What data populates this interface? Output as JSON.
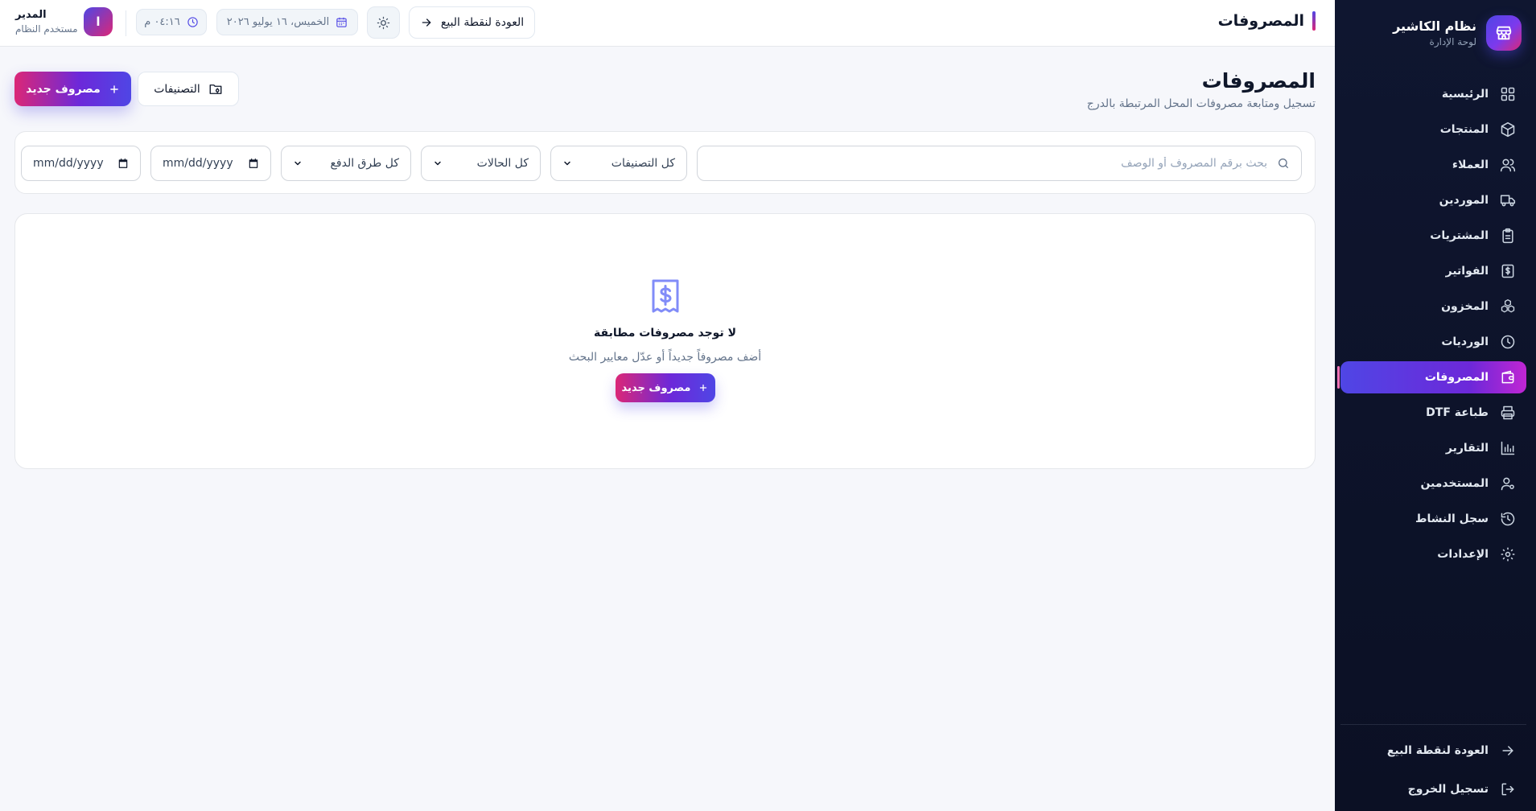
{
  "sidebar": {
    "brand_title": "نظام الكاشير",
    "brand_subtitle": "لوحة الإدارة",
    "items": [
      {
        "label": "الرئيسية",
        "icon": "grid-icon"
      },
      {
        "label": "المنتجات",
        "icon": "box-icon"
      },
      {
        "label": "العملاء",
        "icon": "users-icon"
      },
      {
        "label": "الموردين",
        "icon": "truck-icon"
      },
      {
        "label": "المشتريات",
        "icon": "clipboard-icon"
      },
      {
        "label": "الفواتير",
        "icon": "invoice-icon"
      },
      {
        "label": "المخزون",
        "icon": "boxes-icon"
      },
      {
        "label": "الورديات",
        "icon": "clock-icon"
      },
      {
        "label": "المصروفات",
        "icon": "wallet-icon",
        "active": true
      },
      {
        "label": "طباعة DTF",
        "icon": "printer-icon"
      },
      {
        "label": "التقارير",
        "icon": "bar-chart-icon"
      },
      {
        "label": "المستخدمين",
        "icon": "user-icon"
      },
      {
        "label": "سجل النشاط",
        "icon": "history-icon"
      },
      {
        "label": "الإعدادات",
        "icon": "gear-icon"
      }
    ],
    "footer": {
      "back_label": "العودة لنقطة البيع",
      "logout_label": "تسجيل الخروج"
    }
  },
  "header": {
    "title": "المصروفات",
    "back_button": "العودة لنقطة البيع",
    "date": "الخميس، ١٦ يوليو ٢٠٢٦",
    "time": "٠٤:١٦ م",
    "user_initial": "ا",
    "user_name": "المدير",
    "user_role": "مستخدم النظام"
  },
  "page": {
    "title": "المصروفات",
    "subtitle": "تسجيل ومتابعة مصروفات المحل المرتبطة بالدرج",
    "new_expense_button": "مصروف جديد",
    "categories_button": "التصنيفات"
  },
  "filters": {
    "search_placeholder": "بحث برقم المصروف أو الوصف",
    "search_value": "",
    "category_selected": "كل التصنيفات",
    "status_selected": "كل الحالات",
    "payment_selected": "كل طرق الدفع",
    "date_to_placeholder": "mm/dd/yyyy",
    "date_from_placeholder": "mm/dd/yyyy"
  },
  "empty_state": {
    "title": "لا توجد مصروفات مطابقة",
    "subtitle": "أضف مصروفاً جديداً أو عدّل معايير البحث",
    "button": "مصروف جديد"
  },
  "colors": {
    "accent_start": "#4f46e5",
    "accent_end": "#db2777",
    "sidebar_bg": "#0f1630",
    "page_bg": "#f6f7fb"
  }
}
